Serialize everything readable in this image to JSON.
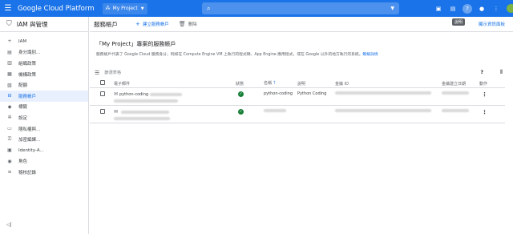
{
  "topbar": {
    "brand": "Google Cloud Platform",
    "project": "My Project",
    "search_icon": "search-icon",
    "tooltip": "說明"
  },
  "sidebar": {
    "title": "IAM 與管理",
    "items": [
      {
        "label": "IAM",
        "icon": "person-add-icon"
      },
      {
        "label": "身分識別...",
        "icon": "identity-icon"
      },
      {
        "label": "組織政策",
        "icon": "policy-icon"
      },
      {
        "label": "機構政策",
        "icon": "org-icon"
      },
      {
        "label": "配額",
        "icon": "quota-icon"
      },
      {
        "label": "服務帳戶",
        "icon": "service-account-icon"
      },
      {
        "label": "標籤",
        "icon": "label-icon"
      },
      {
        "label": "設定",
        "icon": "settings-icon"
      },
      {
        "label": "隱私權與...",
        "icon": "privacy-icon"
      },
      {
        "label": "加密編譯...",
        "icon": "key-icon"
      },
      {
        "label": "Identity-A...",
        "icon": "identity-aware-icon"
      },
      {
        "label": "角色",
        "icon": "roles-icon"
      },
      {
        "label": "稽核記錄",
        "icon": "audit-icon"
      }
    ],
    "active_index": 5
  },
  "actionbar": {
    "title": "服務帳戶",
    "create_label": "建立服務帳戶",
    "delete_label": "刪除",
    "link_label": "顯示資訊面板"
  },
  "header": {
    "heading": "「My Project」專案的服務帳戶",
    "description": "服務帳戶代表了 Google Cloud 服務身分，例如在 Compute Engine VM 上執行的程式碼、App Engine 應用程式，或在 Google 以外的地方執行的系統。",
    "learn_more": "瞭解詳情"
  },
  "filter": {
    "placeholder": "篩選表格"
  },
  "table": {
    "columns": [
      "電子郵件",
      "狀態",
      "名稱",
      "說明",
      "金鑰 ID",
      "金鑰建立日期",
      "動作"
    ],
    "rows": [
      {
        "email": "python-coding",
        "status": "ok",
        "name": "python-coding",
        "description": "Python Coding"
      },
      {
        "email": "",
        "status": "ok",
        "name": "",
        "description": ""
      }
    ]
  }
}
